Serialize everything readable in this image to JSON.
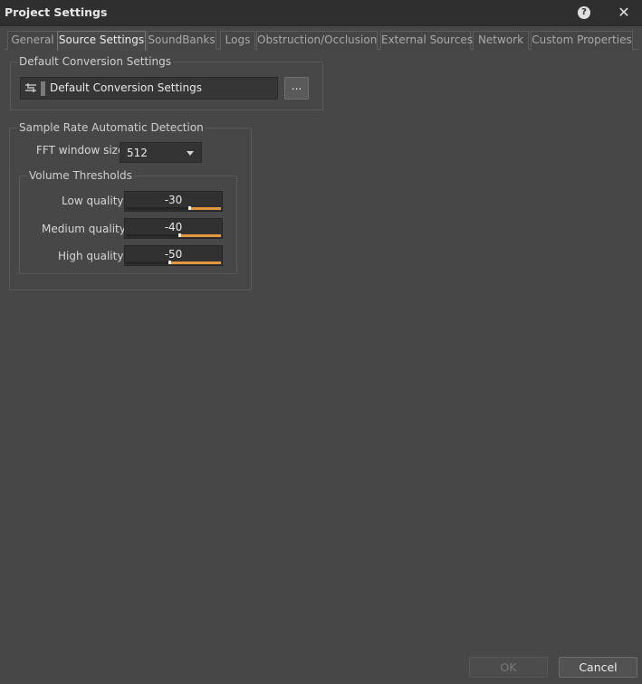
{
  "window": {
    "title": "Project Settings",
    "help_icon": "question-mark-icon",
    "close_icon": "close-icon",
    "help_glyph": "?",
    "close_glyph": "✕"
  },
  "tabs": [
    {
      "label": "General",
      "active": false
    },
    {
      "label": "Source Settings",
      "active": true
    },
    {
      "label": "SoundBanks",
      "active": false
    },
    {
      "label": "Logs",
      "active": false
    },
    {
      "label": "Obstruction/Occlusion",
      "active": false
    },
    {
      "label": "External Sources",
      "active": false
    },
    {
      "label": "Network",
      "active": false
    },
    {
      "label": "Custom Properties",
      "active": false
    }
  ],
  "default_conversion": {
    "group_label": "Default Conversion Settings",
    "value": "Default Conversion Settings",
    "icon": "conversion-settings-icon",
    "browse_label": "..."
  },
  "sample_rate": {
    "group_label": "Sample Rate Automatic Detection",
    "fft_label": "FFT window size",
    "fft_value": "512",
    "volume_thresholds": {
      "group_label": "Volume Thresholds",
      "rows": [
        {
          "label": "Low quality",
          "value": "-30",
          "fill_fraction": 0.32
        },
        {
          "label": "Medium quality",
          "value": "-40",
          "fill_fraction": 0.43
        },
        {
          "label": "High quality",
          "value": "-50",
          "fill_fraction": 0.53
        }
      ]
    }
  },
  "footer": {
    "ok_label": "OK",
    "ok_enabled": false,
    "cancel_label": "Cancel"
  },
  "colors": {
    "background": "#474747",
    "titlebar": "#2f2f2f",
    "slider_fill": "#e0973f"
  }
}
